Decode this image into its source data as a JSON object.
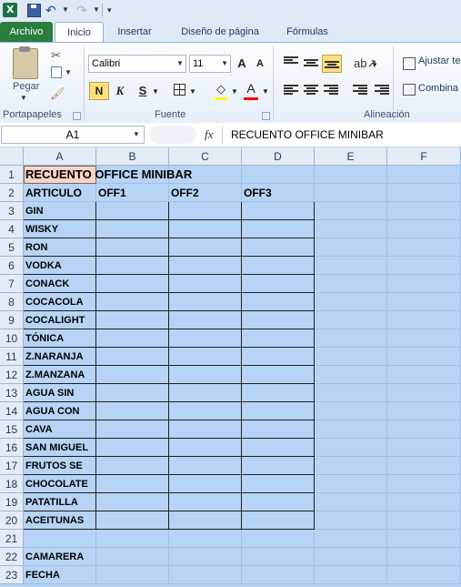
{
  "quick_access": {
    "excel_glyph": "X"
  },
  "tabs": [
    {
      "label": "Archivo"
    },
    {
      "label": "Inicio"
    },
    {
      "label": "Insertar"
    },
    {
      "label": "Diseño de página"
    },
    {
      "label": "Fórmulas"
    }
  ],
  "ribbon": {
    "clipboard": {
      "paste_label": "Pegar",
      "group_label": "Portapapeles"
    },
    "font": {
      "font_name": "Calibri",
      "font_size": "11",
      "bold_label": "N",
      "italic_label": "K",
      "underline_label": "S",
      "grow_label": "A",
      "shrink_label": "A",
      "font_color_label": "A",
      "group_label": "Fuente",
      "fill_color": "#ffff00",
      "font_color": "#ff0000"
    },
    "alignment": {
      "wrap_label": "Ajustar te",
      "merge_label": "Combina",
      "group_label": "Alineación"
    }
  },
  "formula_bar": {
    "name_box": "A1",
    "fx_label": "fx",
    "value": "RECUENTO OFFICE MINIBAR"
  },
  "columns": [
    "A",
    "B",
    "C",
    "D",
    "E",
    "F"
  ],
  "rows": [
    "1",
    "2",
    "3",
    "4",
    "5",
    "6",
    "7",
    "8",
    "9",
    "10",
    "11",
    "12",
    "13",
    "14",
    "15",
    "16",
    "17",
    "18",
    "19",
    "20",
    "21",
    "22",
    "23"
  ],
  "sheet": {
    "title": "RECUENTO OFFICE MINIBAR",
    "headers": [
      "ARTICULO",
      "OFF1",
      "OFF2",
      "OFF3"
    ],
    "items": [
      "GIN",
      "WISKY",
      "RON",
      "VODKA",
      "CONACK",
      "COCACOLA",
      "COCALIGHT",
      "TÓNICA",
      "Z.NARANJA",
      "Z.MANZANA",
      "AGUA SIN",
      "AGUA CON",
      "CAVA",
      "SAN MIGUEL",
      "FRUTOS SE",
      "CHOCOLATE",
      "PATATILLA",
      "ACEITUNAS"
    ],
    "footer": [
      "CAMARERA",
      "FECHA"
    ],
    "selection_color": "#b7d4f6",
    "active_cell_color": "#f9d3c4"
  }
}
